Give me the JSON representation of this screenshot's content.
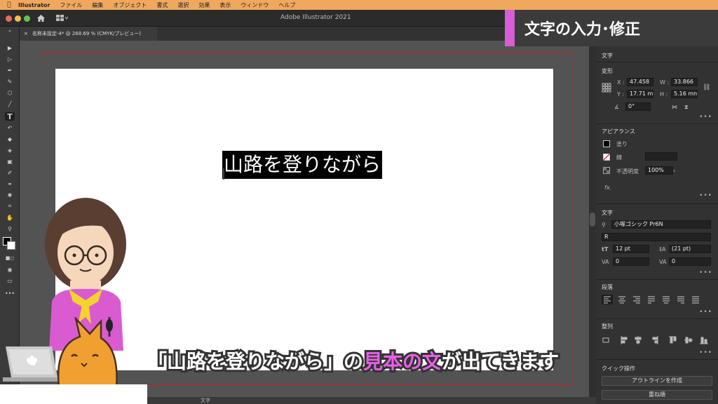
{
  "menubar": {
    "app_name": "Illustrator",
    "items": [
      "ファイル",
      "編集",
      "オブジェクト",
      "書式",
      "選択",
      "効果",
      "表示",
      "ウィンドウ",
      "ヘルプ"
    ]
  },
  "window": {
    "title": "Adobe Illustrator 2021",
    "doc_tab": "名称未設定-4* @ 268.69 % (CMYK/プレビュー)"
  },
  "canvas": {
    "text_object": "山路を登りながら"
  },
  "status": {
    "panel_label": "文字"
  },
  "panel": {
    "header": "文字",
    "transform": {
      "title": "変形",
      "x_label": "X :",
      "x_value": "47.458",
      "w_label": "W :",
      "w_value": "33.866",
      "y_label": "Y :",
      "y_value": "17.71 m",
      "h_label": "H :",
      "h_value": "5.16 mn",
      "angle_value": "0°"
    },
    "appearance": {
      "title": "アピアランス",
      "fill_label": "塗り",
      "stroke_label": "線",
      "opacity_label": "不透明度",
      "opacity_value": "100%",
      "fx_label": "fx."
    },
    "character": {
      "title": "文字",
      "font_family": "小塚ゴシック Pr6N",
      "font_style": "R",
      "font_size": "12 pt",
      "leading": "(21 pt)",
      "kerning": "0",
      "tracking": "0"
    },
    "paragraph": {
      "title": "段落"
    },
    "align": {
      "title": "整列"
    },
    "quick_actions": {
      "title": "クイック操作",
      "outline_button": "アウトラインを作成",
      "arrange_button": "重ね順"
    }
  },
  "overlay": {
    "banner": "文字の入力･修正",
    "subtitle_part1": "「山路を登りながら」の",
    "subtitle_highlight": "見本の文",
    "subtitle_part2": "が出てきます",
    "accent_color": "#d65ed6"
  },
  "colors": {
    "menubar": "#f0a85e",
    "artboard_bleed": "#cc2222",
    "highlight": "#e65fe6"
  }
}
